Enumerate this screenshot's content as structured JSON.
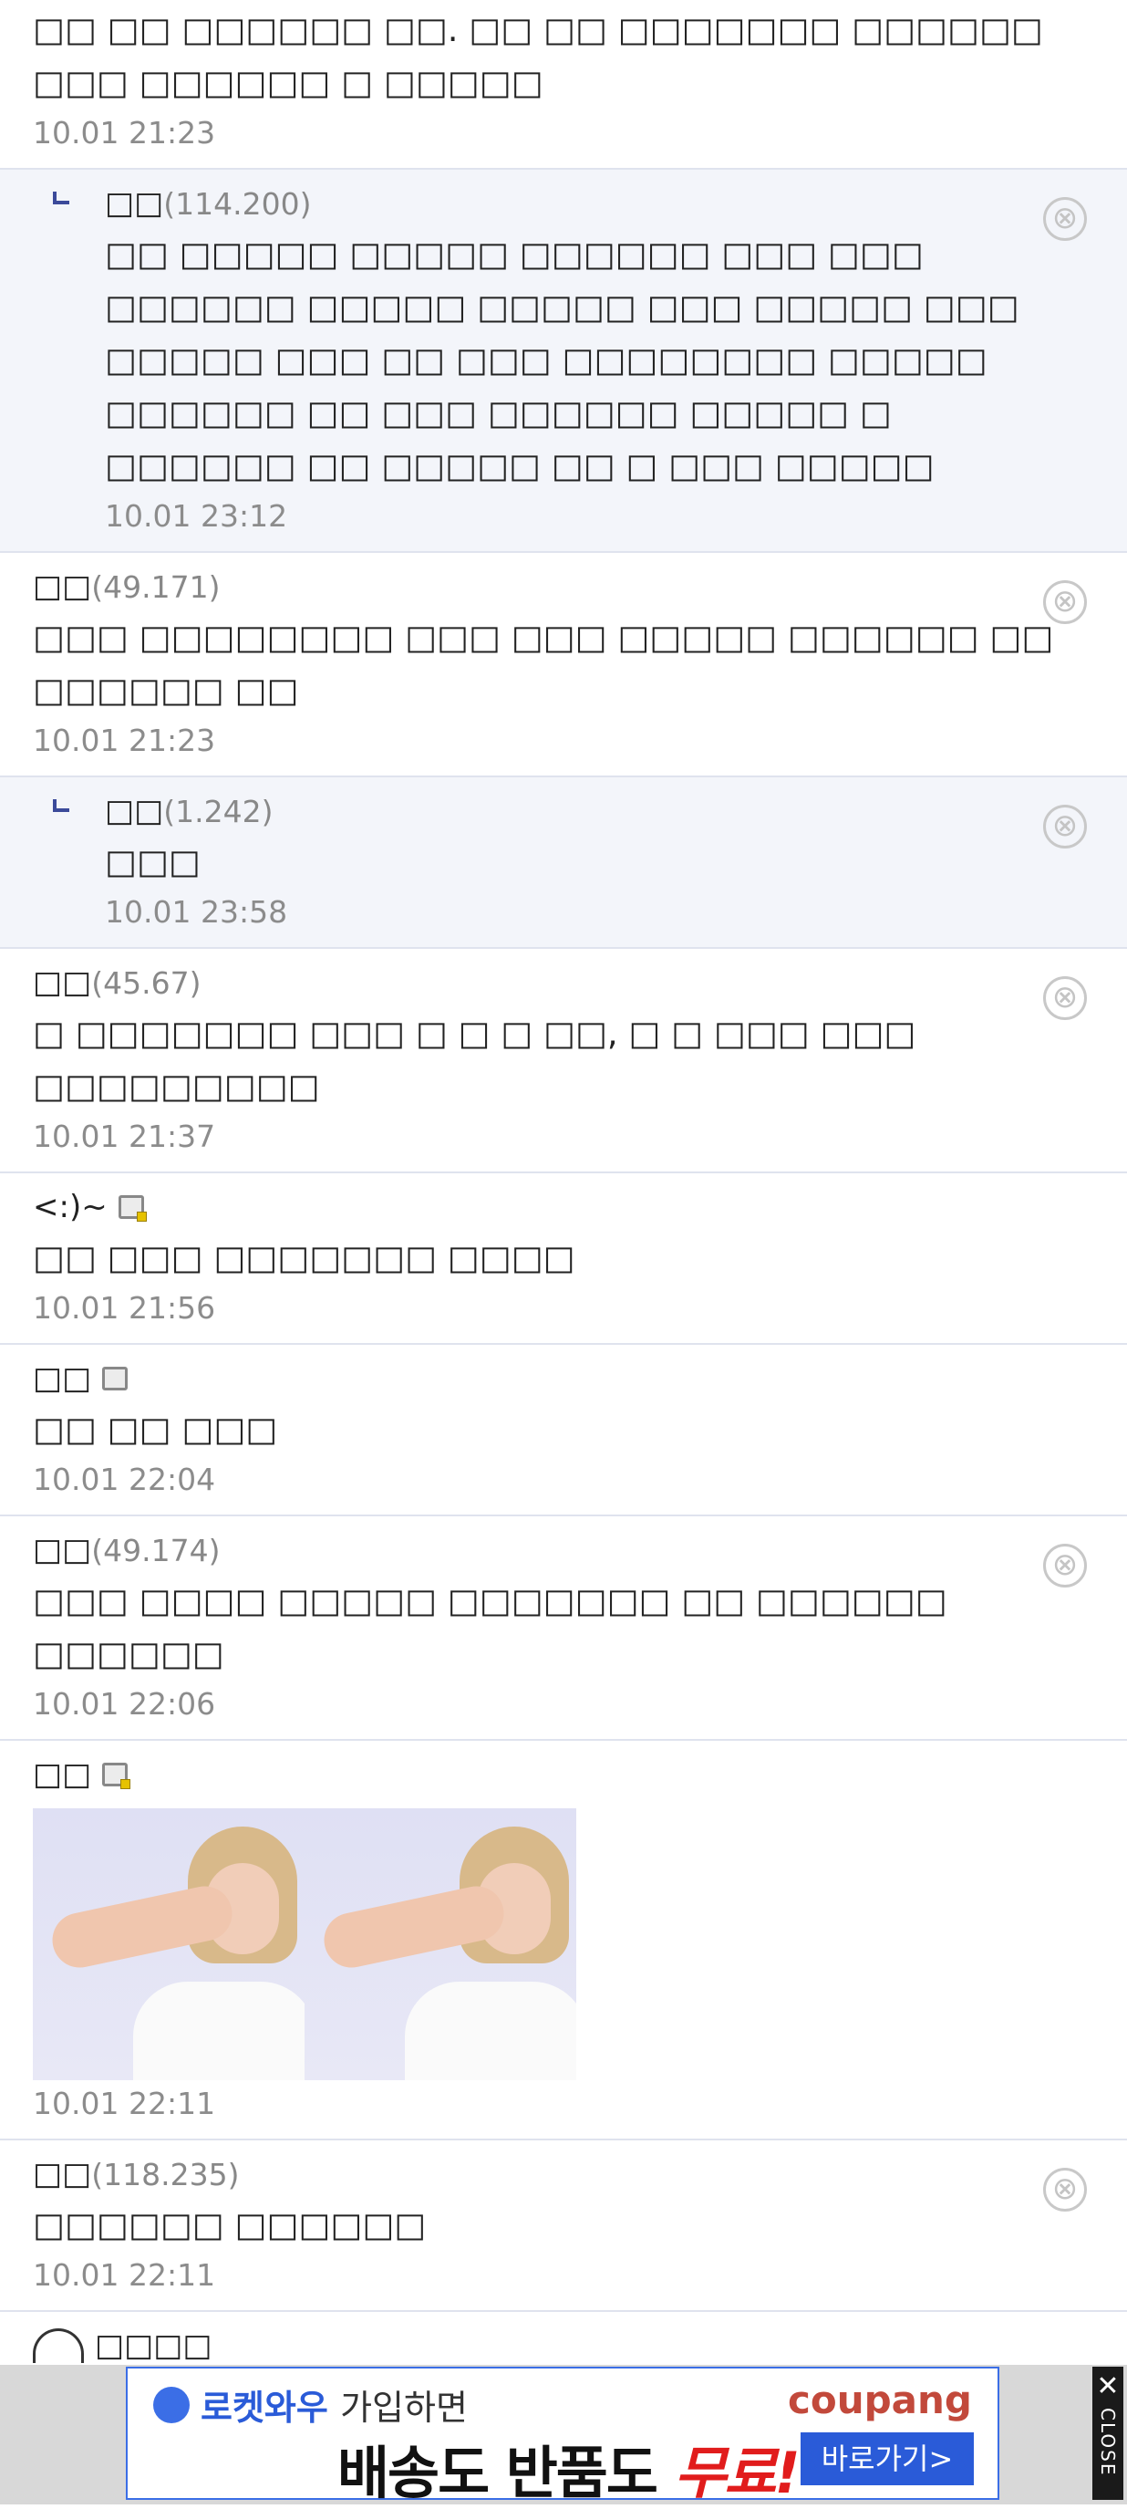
{
  "comments": [
    {
      "type": "comment",
      "partial": true,
      "text": "□□ □□ □□□□□□ □□. □□ □□ □□□□□□□ □□□□□□ □□□ □□□□□□ □ □□□□□",
      "date": "10.01 21:23"
    },
    {
      "type": "reply",
      "nick": "□□",
      "ip": "(114.200)",
      "text": "□□ □□□□□ □□□□□ □□□□□□ □□□ □□□ □□□□□□ □□□□□ □□□□□ □□□ □□□□□ □□□ □□□□□ □□□ □□ □□□ □□□□□□□□ □□□□□ □□□□□□ □□ □□□ □□□□□□ □□□□□ □ □□□□□□ □□ □□□□□ □□ □ □□□ □□□□□",
      "date": "10.01 23:12",
      "deletable": true
    },
    {
      "type": "comment",
      "nick": "□□",
      "ip": "(49.171)",
      "text": "□□□ □□□□□□□□ □□□ □□□ □□□□□ □□□□□□ □□ □□□□□□ □□",
      "date": "10.01 21:23",
      "deletable": true
    },
    {
      "type": "reply",
      "nick": "□□",
      "ip": "(1.242)",
      "text": "□□□",
      "date": "10.01 23:58",
      "deletable": true
    },
    {
      "type": "comment",
      "nick": "□□",
      "ip": "(45.67)",
      "text": "□ □□□□□□□ □□□ □ □ □ □□, □ □ □□□ □□□ □□□□□□□□□",
      "date": "10.01 21:37",
      "deletable": true
    },
    {
      "type": "comment",
      "nick": "<:)~",
      "memo": true,
      "memo_badge": true,
      "text": "□□ □□□ □□□□□□□ □□□□",
      "date": "10.01 21:56"
    },
    {
      "type": "comment",
      "nick": "□□",
      "memo": true,
      "memo_badge": false,
      "text": "□□ □□ □□□",
      "date": "10.01 22:04"
    },
    {
      "type": "comment",
      "nick": "□□",
      "ip": "(49.174)",
      "text": "□□□ □□□□ □□□□□ □□□□□□□ □□ □□□□□□ □□□□□□",
      "date": "10.01 22:06",
      "deletable": true
    },
    {
      "type": "comment",
      "nick": "□□",
      "memo": true,
      "memo_badge": true,
      "images": 2,
      "date": "10.01 22:11"
    },
    {
      "type": "comment",
      "nick": "□□",
      "ip": "(118.235)",
      "text": "□□□□□□ □□□□□□",
      "date": "10.01 22:11",
      "deletable": true
    },
    {
      "type": "comment",
      "nick": "□□□□",
      "bear": true,
      "cut": true
    }
  ],
  "delete_glyph": "⊗",
  "ad": {
    "rocket_text": "로켓와우",
    "join_text": "가입하면",
    "main_1": "배송",
    "main_2": "도 ",
    "main_3": "반품",
    "main_4": "도 ",
    "main_5": "무료!",
    "brand": "coupang",
    "button": "바로가기>",
    "close_x": "✕",
    "close_label": "CLOSE",
    "accent": "#2a5bd8",
    "free_color": "#e11c1c"
  }
}
